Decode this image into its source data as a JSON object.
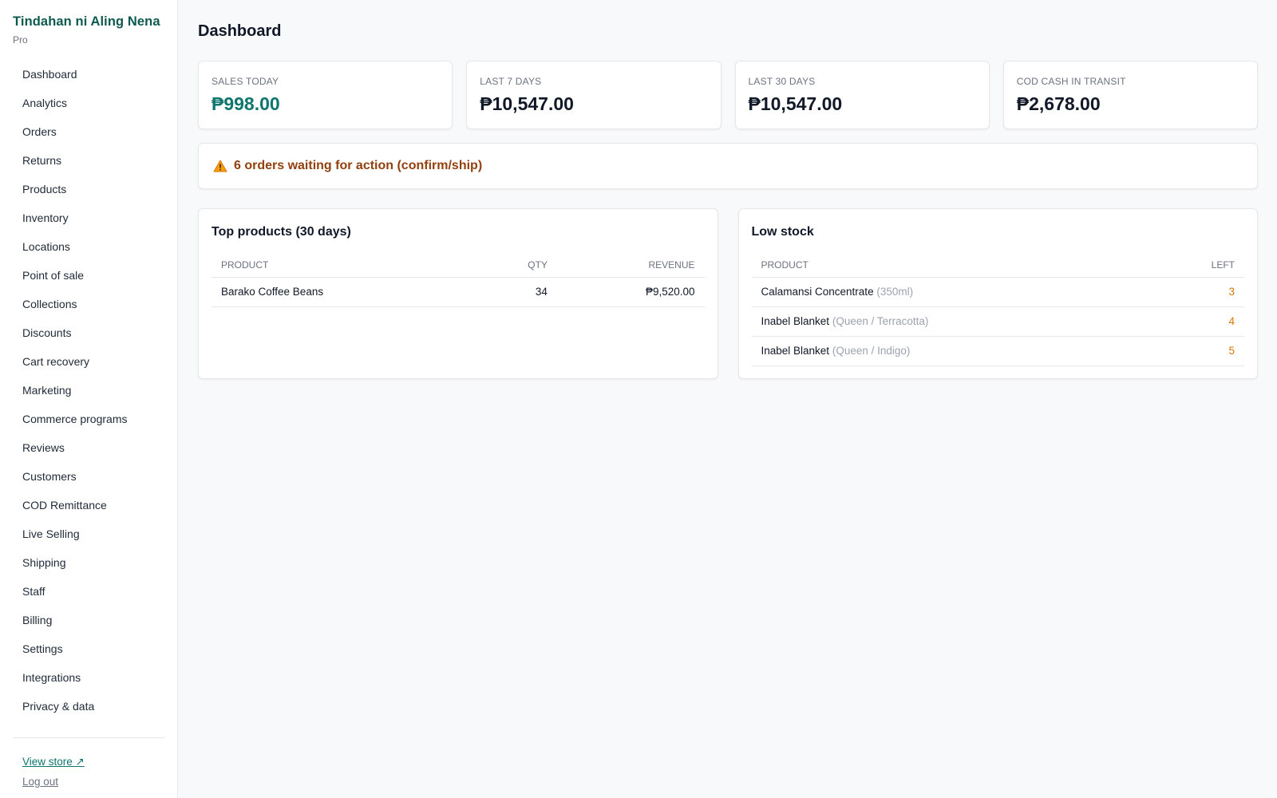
{
  "sidebar": {
    "store_name": "Tindahan ni Aling Nena",
    "plan": "Pro",
    "nav": [
      "Dashboard",
      "Analytics",
      "Orders",
      "Returns",
      "Products",
      "Inventory",
      "Locations",
      "Point of sale",
      "Collections",
      "Discounts",
      "Cart recovery",
      "Marketing",
      "Commerce programs",
      "Reviews",
      "Customers",
      "COD Remittance",
      "Live Selling",
      "Shipping",
      "Staff",
      "Billing",
      "Settings",
      "Integrations",
      "Privacy & data"
    ],
    "view_store": "View store ↗",
    "log_out": "Log out"
  },
  "main": {
    "title": "Dashboard",
    "stats": [
      {
        "label": "SALES TODAY",
        "value": "₱998.00"
      },
      {
        "label": "LAST 7 DAYS",
        "value": "₱10,547.00"
      },
      {
        "label": "LAST 30 DAYS",
        "value": "₱10,547.00"
      },
      {
        "label": "COD CASH IN TRANSIT",
        "value": "₱2,678.00"
      }
    ],
    "alert": {
      "icon": "warning-icon",
      "text": "6 orders waiting for action (confirm/ship)"
    },
    "top_products": {
      "title": "Top products (30 days)",
      "headers": {
        "product": "PRODUCT",
        "qty": "QTY",
        "revenue": "REVENUE"
      },
      "rows": [
        {
          "product": "Barako Coffee Beans",
          "qty": "34",
          "revenue": "₱9,520.00"
        }
      ]
    },
    "low_stock": {
      "title": "Low stock",
      "headers": {
        "product": "PRODUCT",
        "left": "LEFT"
      },
      "rows": [
        {
          "product": "Calamansi Concentrate",
          "variant": "(350ml)",
          "left": "3"
        },
        {
          "product": "Inabel Blanket",
          "variant": "(Queen / Terracotta)",
          "left": "4"
        },
        {
          "product": "Inabel Blanket",
          "variant": "(Queen / Indigo)",
          "left": "5"
        }
      ]
    }
  },
  "colors": {
    "brand": "#0f5a4f",
    "accent": "#0f766e",
    "alert": "#92400e",
    "low_stock": "#d97706"
  }
}
